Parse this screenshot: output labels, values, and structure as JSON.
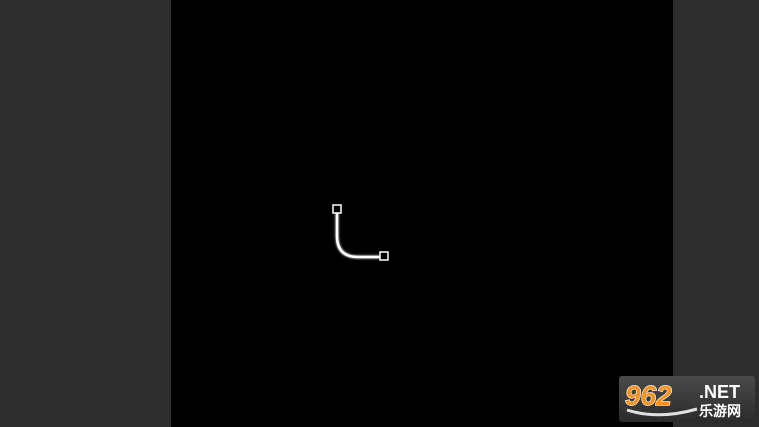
{
  "game": {
    "background_color": "#000000",
    "side_color": "#2d2d2d",
    "line_color": "#ffffff",
    "pipe_path": {
      "start_node": "square-node",
      "end_node": "square-node",
      "shape": "curved-corner"
    }
  },
  "watermark": {
    "number": "962",
    "domain": ".NET",
    "subtitle": "乐游网",
    "number_color": "#f7931e",
    "text_color": "#ffffff"
  }
}
